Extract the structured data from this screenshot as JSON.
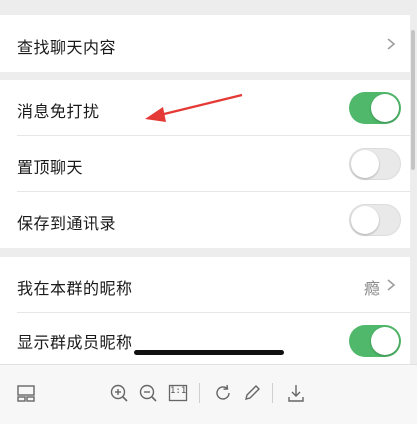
{
  "settings": {
    "search_history": "查找聊天内容",
    "mute": "消息免打扰",
    "sticky": "置顶聊天",
    "save_contacts": "保存到通讯录",
    "my_alias": "我在本群的昵称",
    "my_alias_value": "瘾",
    "show_names": "显示群成员昵称"
  },
  "toggles": {
    "mute": true,
    "sticky": false,
    "save_contacts": false,
    "show_names": true
  },
  "icons": {
    "toolbar": [
      "layout-icon",
      "zoom-in-icon",
      "zoom-out-icon",
      "actual-size-icon",
      "rotate-icon",
      "edit-pen-icon",
      "download-icon"
    ],
    "actual_size_label": "1:1"
  },
  "colors": {
    "toggle_on": "#4fb86a",
    "annotation_arrow": "#e53935"
  }
}
